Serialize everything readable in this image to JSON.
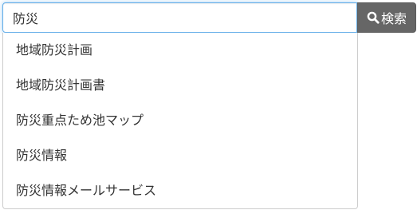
{
  "search": {
    "value": "防災",
    "button_label": "検索",
    "icon": "search-icon"
  },
  "suggestions": [
    {
      "label": "地域防災計画"
    },
    {
      "label": "地域防災計画書"
    },
    {
      "label": "防災重点ため池マップ"
    },
    {
      "label": "防災情報"
    },
    {
      "label": "防災情報メールサービス"
    }
  ],
  "colors": {
    "button_bg": "#666666",
    "input_focus_border": "#66afe9"
  }
}
